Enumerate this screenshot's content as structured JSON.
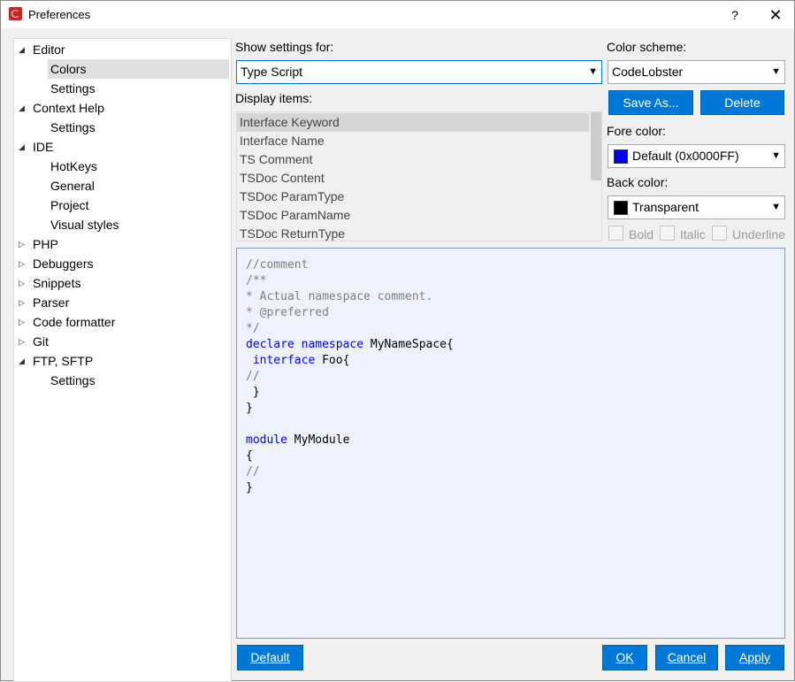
{
  "window": {
    "title": "Preferences",
    "help_label": "?",
    "close_label": "✕"
  },
  "tree": [
    {
      "label": "Editor",
      "expanded": true,
      "level": 0,
      "arrow": "◢"
    },
    {
      "label": "Colors",
      "level": 1,
      "selected": true
    },
    {
      "label": "Settings",
      "level": 1
    },
    {
      "label": "Context Help",
      "expanded": true,
      "level": 0,
      "arrow": "◢"
    },
    {
      "label": "Settings",
      "level": 1
    },
    {
      "label": "IDE",
      "expanded": true,
      "level": 0,
      "arrow": "◢"
    },
    {
      "label": "HotKeys",
      "level": 1
    },
    {
      "label": "General",
      "level": 1
    },
    {
      "label": "Project",
      "level": 1
    },
    {
      "label": "Visual styles",
      "level": 1
    },
    {
      "label": "PHP",
      "level": 0,
      "arrow": "▷"
    },
    {
      "label": "Debuggers",
      "level": 0,
      "arrow": "▷"
    },
    {
      "label": "Snippets",
      "level": 0,
      "arrow": "▷"
    },
    {
      "label": "Parser",
      "level": 0,
      "arrow": "▷"
    },
    {
      "label": "Code formatter",
      "level": 0,
      "arrow": "▷"
    },
    {
      "label": "Git",
      "level": 0,
      "arrow": "▷"
    },
    {
      "label": "FTP, SFTP",
      "expanded": true,
      "level": 0,
      "arrow": "◢"
    },
    {
      "label": "Settings",
      "level": 1
    }
  ],
  "show_settings": {
    "label": "Show settings for:",
    "value": "Type Script",
    "arrow": "▼"
  },
  "display_items": {
    "label": "Display items:",
    "items": [
      "Interface Keyword",
      "Interface Name",
      "TS Comment",
      "TSDoc Content",
      "TSDoc ParamType",
      "TSDoc ParamName",
      "TSDoc ReturnType"
    ],
    "selected_index": 0
  },
  "color_scheme": {
    "label": "Color scheme:",
    "value": "CodeLobster",
    "arrow": "▼"
  },
  "buttons": {
    "save_as_prefix": "Save As...",
    "delete": "Delete",
    "default": "Default",
    "ok": "OK",
    "cancel": "Cancel",
    "apply": "Apply"
  },
  "fore_color": {
    "label": "Fore color:",
    "value": "Default (0x0000FF)",
    "swatch": "#0000ff",
    "arrow": "▼"
  },
  "back_color": {
    "label": "Back color:",
    "value": "Transparent",
    "swatch": "#000000",
    "arrow": "▼"
  },
  "styles": {
    "bold": "Bold",
    "italic": "Italic",
    "underline": "Underline"
  },
  "preview": {
    "lines": [
      [
        {
          "t": "//comment",
          "c": "comment"
        }
      ],
      [
        {
          "t": "/**",
          "c": "comment"
        }
      ],
      [
        {
          "t": "* Actual namespace comment.",
          "c": "comment"
        }
      ],
      [
        {
          "t": "* @preferred",
          "c": "comment"
        }
      ],
      [
        {
          "t": "*/",
          "c": "comment"
        }
      ],
      [
        {
          "t": "declare",
          "c": "kw"
        },
        {
          "t": " ",
          "c": "plain"
        },
        {
          "t": "namespace",
          "c": "kw"
        },
        {
          "t": " MyNameSpace{",
          "c": "plain"
        }
      ],
      [
        {
          "t": " ",
          "c": "plain"
        },
        {
          "t": "interface",
          "c": "kw"
        },
        {
          "t": " Foo{",
          "c": "plain"
        }
      ],
      [
        {
          "t": "//",
          "c": "comment"
        }
      ],
      [
        {
          "t": " }",
          "c": "plain"
        }
      ],
      [
        {
          "t": "}",
          "c": "plain"
        }
      ],
      [],
      [
        {
          "t": "module",
          "c": "kw"
        },
        {
          "t": " MyModule",
          "c": "plain"
        }
      ],
      [
        {
          "t": "{",
          "c": "plain"
        }
      ],
      [
        {
          "t": "//",
          "c": "comment"
        }
      ],
      [
        {
          "t": "}",
          "c": "plain"
        }
      ]
    ]
  }
}
